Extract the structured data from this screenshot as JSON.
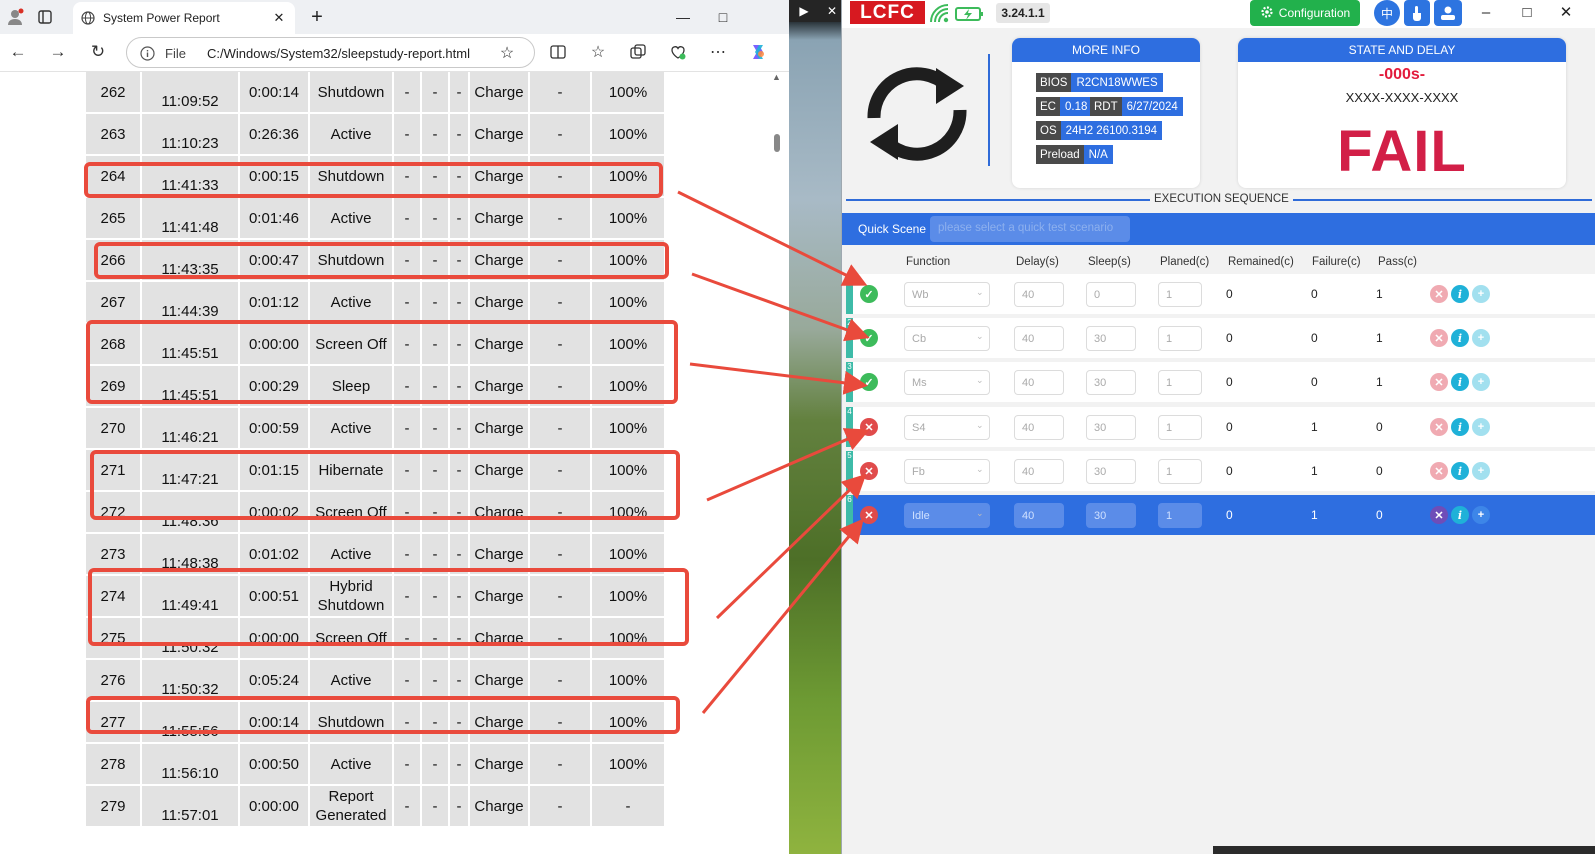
{
  "browser": {
    "tab_title": "System Power Report",
    "address_prefix": "File",
    "url": "C:/Windows/System32/sleepstudy-report.html",
    "icons": [
      "profile-icon",
      "tab-actions-icon",
      "globe-icon",
      "close-tab-icon",
      "new-tab-icon",
      "minimize-icon",
      "maximize-icon",
      "back-icon",
      "forward-icon",
      "refresh-icon",
      "info-icon",
      "favorite-star-icon",
      "split-screen-icon",
      "favorites-icon",
      "collections-icon",
      "browser-essentials-icon",
      "more-icon",
      "copilot-icon"
    ]
  },
  "report_rows": [
    {
      "id": "262",
      "time": "11:09:52",
      "duration": "0:00:14",
      "state": "Shutdown",
      "c1": "-",
      "c2": "-",
      "c3": "-",
      "source": "Charge",
      "c4": "-",
      "battery": "100%"
    },
    {
      "id": "263",
      "time": "11:10:23",
      "duration": "0:26:36",
      "state": "Active",
      "c1": "-",
      "c2": "-",
      "c3": "-",
      "source": "Charge",
      "c4": "-",
      "battery": "100%"
    },
    {
      "id": "264",
      "time": "11:41:33",
      "duration": "0:00:15",
      "state": "Shutdown",
      "c1": "-",
      "c2": "-",
      "c3": "-",
      "source": "Charge",
      "c4": "-",
      "battery": "100%"
    },
    {
      "id": "265",
      "time": "11:41:48",
      "duration": "0:01:46",
      "state": "Active",
      "c1": "-",
      "c2": "-",
      "c3": "-",
      "source": "Charge",
      "c4": "-",
      "battery": "100%"
    },
    {
      "id": "266",
      "time": "11:43:35",
      "duration": "0:00:47",
      "state": "Shutdown",
      "c1": "-",
      "c2": "-",
      "c3": "-",
      "source": "Charge",
      "c4": "-",
      "battery": "100%"
    },
    {
      "id": "267",
      "time": "11:44:39",
      "duration": "0:01:12",
      "state": "Active",
      "c1": "-",
      "c2": "-",
      "c3": "-",
      "source": "Charge",
      "c4": "-",
      "battery": "100%"
    },
    {
      "id": "268",
      "time": "11:45:51",
      "duration": "0:00:00",
      "state": "Screen Off",
      "c1": "-",
      "c2": "-",
      "c3": "-",
      "source": "Charge",
      "c4": "-",
      "battery": "100%"
    },
    {
      "id": "269",
      "time": "11:45:51",
      "duration": "0:00:29",
      "state": "Sleep",
      "c1": "-",
      "c2": "-",
      "c3": "-",
      "source": "Charge",
      "c4": "-",
      "battery": "100%"
    },
    {
      "id": "270",
      "time": "11:46:21",
      "duration": "0:00:59",
      "state": "Active",
      "c1": "-",
      "c2": "-",
      "c3": "-",
      "source": "Charge",
      "c4": "-",
      "battery": "100%"
    },
    {
      "id": "271",
      "time": "11:47:21",
      "duration": "0:01:15",
      "state": "Hibernate",
      "c1": "-",
      "c2": "-",
      "c3": "-",
      "source": "Charge",
      "c4": "-",
      "battery": "100%"
    },
    {
      "id": "272",
      "time": "11:48:36",
      "duration": "0:00:02",
      "state": "Screen Off",
      "c1": "-",
      "c2": "-",
      "c3": "-",
      "source": "Charge",
      "c4": "-",
      "battery": "100%"
    },
    {
      "id": "273",
      "time": "11:48:38",
      "duration": "0:01:02",
      "state": "Active",
      "c1": "-",
      "c2": "-",
      "c3": "-",
      "source": "Charge",
      "c4": "-",
      "battery": "100%"
    },
    {
      "id": "274",
      "time": "11:49:41",
      "duration": "0:00:51",
      "state": "Hybrid Shutdown",
      "c1": "-",
      "c2": "-",
      "c3": "-",
      "source": "Charge",
      "c4": "-",
      "battery": "100%"
    },
    {
      "id": "275",
      "time": "11:50:32",
      "duration": "0:00:00",
      "state": "Screen Off",
      "c1": "-",
      "c2": "-",
      "c3": "-",
      "source": "Charge",
      "c4": "-",
      "battery": "100%"
    },
    {
      "id": "276",
      "time": "11:50:32",
      "duration": "0:05:24",
      "state": "Active",
      "c1": "-",
      "c2": "-",
      "c3": "-",
      "source": "Charge",
      "c4": "-",
      "battery": "100%"
    },
    {
      "id": "277",
      "time": "11:55:56",
      "duration": "0:00:14",
      "state": "Shutdown",
      "c1": "-",
      "c2": "-",
      "c3": "-",
      "source": "Charge",
      "c4": "-",
      "battery": "100%"
    },
    {
      "id": "278",
      "time": "11:56:10",
      "duration": "0:00:50",
      "state": "Active",
      "c1": "-",
      "c2": "-",
      "c3": "-",
      "source": "Charge",
      "c4": "-",
      "battery": "100%"
    },
    {
      "id": "279",
      "time": "11:57:01",
      "duration": "0:00:00",
      "state": "Report Generated",
      "c1": "-",
      "c2": "-",
      "c3": "-",
      "source": "Charge",
      "c4": "-",
      "battery": "-"
    }
  ],
  "wallpaper_ctrls": [
    "▶",
    "✕"
  ],
  "app": {
    "logo": "LCFC",
    "version": "3.24.1.1",
    "config_label": "Configuration",
    "lang_label": "中",
    "window_controls": [
      "–",
      "□",
      "✕"
    ],
    "more_info": {
      "title": "MORE INFO",
      "bios_k": "BIOS",
      "bios_v": "R2CN18WWES",
      "ec_k": "EC",
      "ec_v": "0.18",
      "rdt_k": "RDT",
      "rdt_v": "6/27/2024",
      "os_k": "OS",
      "os_v": "24H2 26100.3194",
      "preload_k": "Preload",
      "preload_v": "N/A"
    },
    "state_delay": {
      "title": "STATE AND DELAY",
      "delay": "-000s-",
      "code": "XXXX-XXXX-XXXX",
      "result": "FAIL",
      "result_color": "#d21f47"
    },
    "execution_label": "EXECUTION SEQUENCE",
    "quick_scene_label": "Quick Scene",
    "quick_scene_placeholder": "please select a quick test scenario",
    "columns": [
      "Function",
      "Delay(s)",
      "Sleep(s)",
      "Planed(c)",
      "Remained(c)",
      "Failure(c)",
      "Pass(c)"
    ],
    "sequence": [
      {
        "num": "1",
        "status": "pass",
        "function": "Wb",
        "delay": "40",
        "sleep": "0",
        "planned": "1",
        "remained": "0",
        "failure": "0",
        "pass": "1"
      },
      {
        "num": "2",
        "status": "pass",
        "function": "Cb",
        "delay": "40",
        "sleep": "30",
        "planned": "1",
        "remained": "0",
        "failure": "0",
        "pass": "1"
      },
      {
        "num": "3",
        "status": "pass",
        "function": "Ms",
        "delay": "40",
        "sleep": "30",
        "planned": "1",
        "remained": "0",
        "failure": "0",
        "pass": "1"
      },
      {
        "num": "4",
        "status": "fail",
        "function": "S4",
        "delay": "40",
        "sleep": "30",
        "planned": "1",
        "remained": "0",
        "failure": "1",
        "pass": "0"
      },
      {
        "num": "5",
        "status": "fail",
        "function": "Fb",
        "delay": "40",
        "sleep": "30",
        "planned": "1",
        "remained": "0",
        "failure": "1",
        "pass": "0"
      },
      {
        "num": "6",
        "status": "fail",
        "function": "Idle",
        "delay": "40",
        "sleep": "30",
        "planned": "1",
        "remained": "0",
        "failure": "1",
        "pass": "0"
      }
    ],
    "status_glyphs": {
      "pass": "✓",
      "fail": "✕"
    },
    "action_glyphs": {
      "del": "✕",
      "info": "i",
      "add": "+"
    }
  },
  "colors": {
    "highlight": "#e94a3c",
    "accent_blue": "#2e6ee0",
    "pass_green": "#3dbb5b",
    "fail_red": "#e04b4b"
  }
}
